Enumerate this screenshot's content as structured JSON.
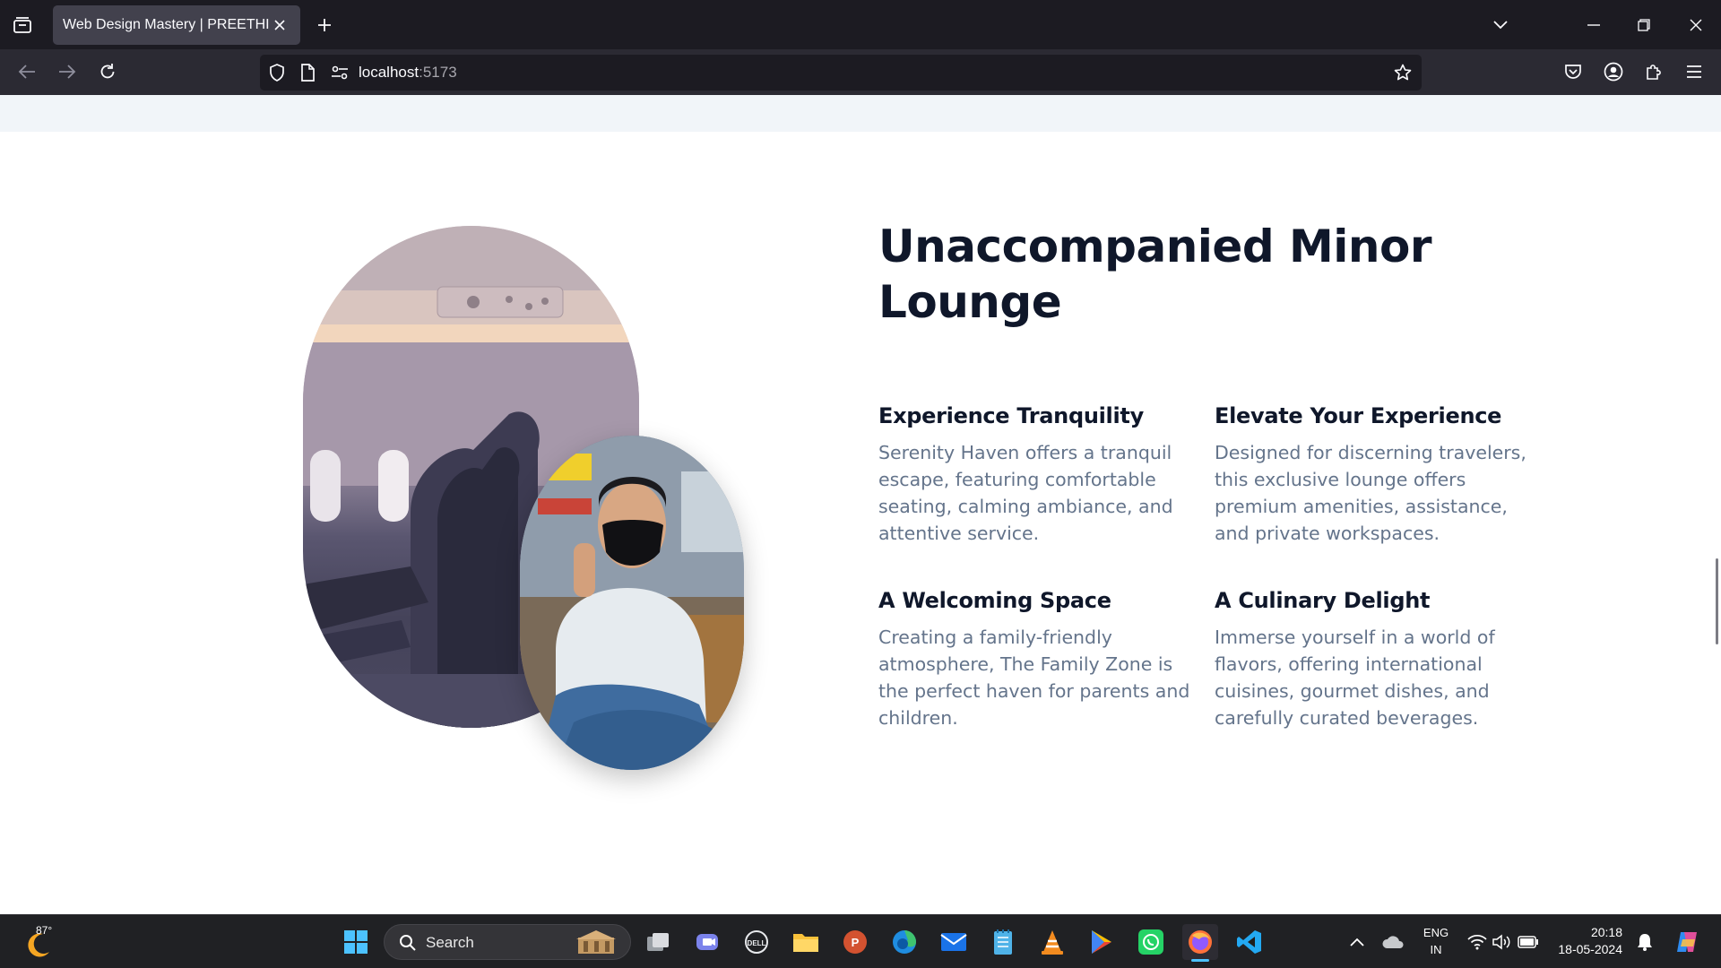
{
  "browser": {
    "tab_title": "Web Design Mastery | PREETHI",
    "url_host": "localhost",
    "url_port": ":5173"
  },
  "section": {
    "title": "Unaccompanied Minor Lounge",
    "features": [
      {
        "heading": "Experience Tranquility",
        "text": "Serenity Haven offers a tranquil escape, featuring comfortable seating, calming ambiance, and attentive service."
      },
      {
        "heading": "Elevate Your Experience",
        "text": "Designed for discerning travelers, this exclusive lounge offers premium amenities, assistance, and private workspaces."
      },
      {
        "heading": "A Welcoming Space",
        "text": "Creating a family-friendly atmosphere, The Family Zone is the perfect haven for parents and children."
      },
      {
        "heading": "A Culinary Delight",
        "text": "Immerse yourself in a world of flavors, offering international cuisines, gourmet dishes, and carefully curated beverages."
      }
    ]
  },
  "taskbar": {
    "weather_temp": "87°",
    "search_label": "Search",
    "lang_line1": "ENG",
    "lang_line2": "IN",
    "time": "20:18",
    "date": "18-05-2024"
  },
  "colors": {
    "heading": "#0f172a",
    "body_text": "#64748b",
    "band": "#f1f5f9"
  }
}
